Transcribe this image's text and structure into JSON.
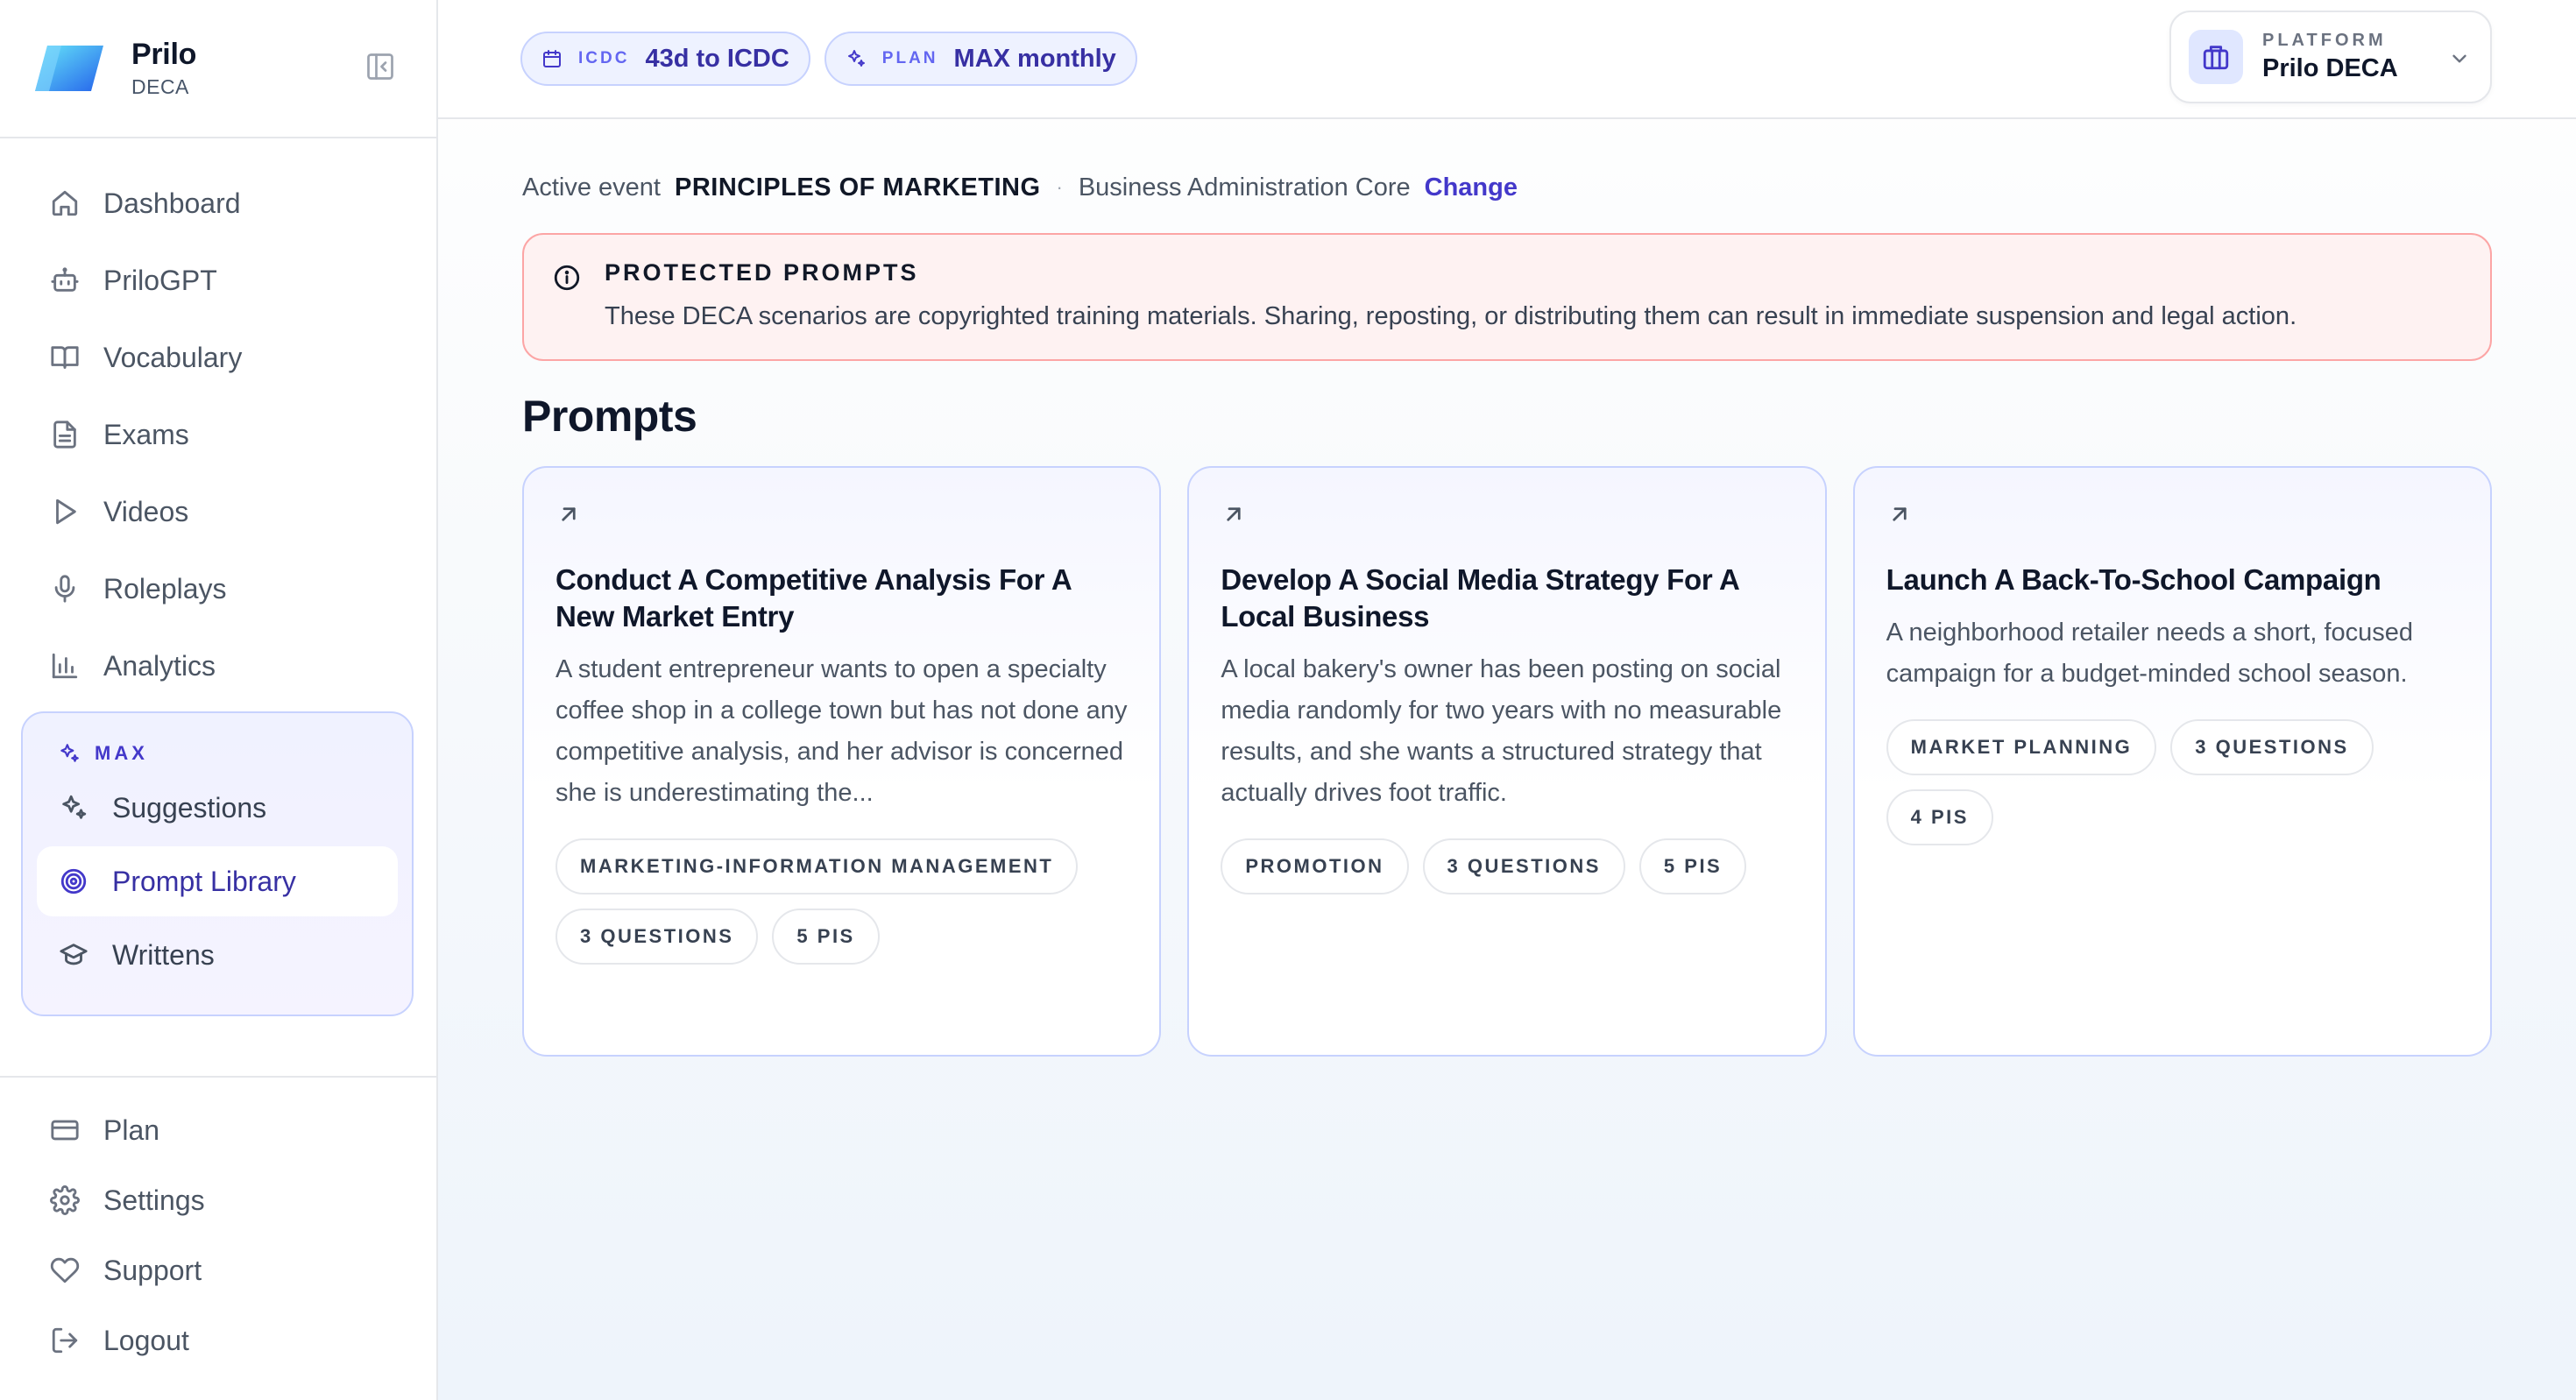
{
  "brand": {
    "name": "Prilo",
    "sub": "DECA"
  },
  "nav": [
    {
      "label": "Dashboard",
      "icon": "home-icon"
    },
    {
      "label": "PriloGPT",
      "icon": "bot-icon"
    },
    {
      "label": "Vocabulary",
      "icon": "book-icon"
    },
    {
      "label": "Exams",
      "icon": "file-text-icon"
    },
    {
      "label": "Videos",
      "icon": "play-icon"
    },
    {
      "label": "Roleplays",
      "icon": "mic-icon"
    },
    {
      "label": "Analytics",
      "icon": "bar-chart-icon"
    }
  ],
  "max": {
    "label": "MAX",
    "items": [
      {
        "label": "Suggestions",
        "icon": "sparkles-icon"
      },
      {
        "label": "Prompt Library",
        "icon": "target-icon",
        "active": true
      },
      {
        "label": "Writtens",
        "icon": "graduation-cap-icon"
      }
    ]
  },
  "bottom_nav": [
    {
      "label": "Plan",
      "icon": "credit-card-icon"
    },
    {
      "label": "Settings",
      "icon": "gear-icon"
    },
    {
      "label": "Support",
      "icon": "heart-icon"
    },
    {
      "label": "Logout",
      "icon": "logout-icon"
    }
  ],
  "topbar": {
    "icdc": {
      "label": "ICDC",
      "value": "43d to ICDC"
    },
    "plan": {
      "label": "PLAN",
      "value": "MAX monthly"
    },
    "platform": {
      "label": "PLATFORM",
      "value": "Prilo DECA"
    }
  },
  "active_event": {
    "label": "Active event",
    "event": "PRINCIPLES OF MARKETING",
    "separator": "·",
    "cluster": "Business Administration Core",
    "change": "Change"
  },
  "alert": {
    "title": "PROTECTED PROMPTS",
    "text": "These DECA scenarios are copyrighted training materials. Sharing, reposting, or distributing them can result in immediate suspension and legal action."
  },
  "section_title": "Prompts",
  "cards": [
    {
      "title": "Conduct A Competitive Analysis For A New Market Entry",
      "description": "A student entrepreneur wants to open a specialty coffee shop in a college town but has not done any competitive analysis, and her advisor is concerned she is underestimating the...",
      "tags": [
        "MARKETING-INFORMATION MANAGEMENT",
        "3 QUESTIONS",
        "5 PIS"
      ]
    },
    {
      "title": "Develop A Social Media Strategy For A Local Business",
      "description": "A local bakery's owner has been posting on social media randomly for two years with no measurable results, and she wants a structured strategy that actually drives foot traffic.",
      "tags": [
        "PROMOTION",
        "3 QUESTIONS",
        "5 PIS"
      ]
    },
    {
      "title": "Launch A Back-To-School Campaign",
      "description": "A neighborhood retailer needs a short, focused campaign for a budget-minded school season.",
      "tags": [
        "MARKET PLANNING",
        "3 QUESTIONS",
        "4 PIS"
      ]
    }
  ],
  "colors": {
    "accent": "#4338ca",
    "accent_light": "#eef2ff",
    "alert_bg": "#fef2f2",
    "alert_border": "#fca5a5"
  }
}
